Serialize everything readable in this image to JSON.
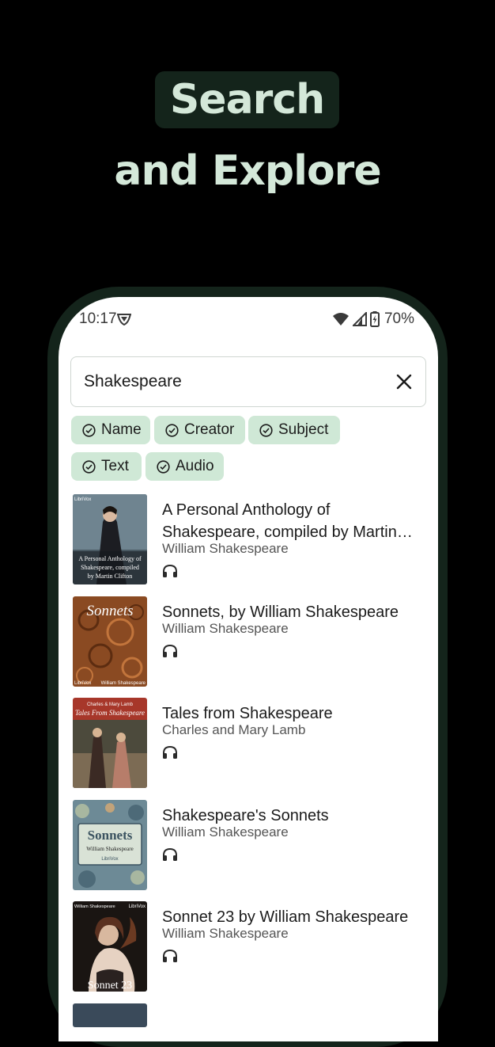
{
  "promo": {
    "line1": "Search",
    "line2": "and Explore"
  },
  "status_bar": {
    "time": "10:17",
    "battery": "70%"
  },
  "search": {
    "value": "Shakespeare",
    "placeholder": ""
  },
  "filters": [
    {
      "label": "Name",
      "checked": true
    },
    {
      "label": "Creator",
      "checked": true
    },
    {
      "label": "Subject",
      "checked": true
    },
    {
      "label": "Text",
      "checked": true
    },
    {
      "label": "Audio",
      "checked": true
    }
  ],
  "results": [
    {
      "title": "A Personal Anthology of Shakespeare, compiled by Martin Clifton",
      "author": "William Shakespeare",
      "media": "headphones-icon",
      "cover_lines": [
        "LibriVox",
        "A Personal Anthology of",
        "Shakespeare, compiled",
        "by Martin Clifton"
      ]
    },
    {
      "title": "Sonnets, by William Shakespeare",
      "author": "William Shakespeare",
      "media": "headphones-icon",
      "cover_lines": [
        "Sonnets",
        "LibriVox",
        "William Shakespeare"
      ]
    },
    {
      "title": "Tales from Shakespeare",
      "author": "Charles and Mary Lamb",
      "media": "headphones-icon",
      "cover_lines": [
        "Charles & Mary Lamb",
        "Tales From Shakespeare"
      ]
    },
    {
      "title": "Shakespeare's Sonnets",
      "author": "William Shakespeare",
      "media": "headphones-icon",
      "cover_lines": [
        "Sonnets",
        "William Shakespeare",
        "LibriVox"
      ]
    },
    {
      "title": "Sonnet 23 by William Shakespeare",
      "author": "William Shakespeare",
      "media": "headphones-icon",
      "cover_lines": [
        "William Shakespeare",
        "LibriVox",
        "Sonnet 23"
      ]
    }
  ],
  "colors": {
    "accent_dark": "#14241b",
    "headline_text": "#d4e8d9",
    "chip_bg": "#cfe8d6"
  }
}
